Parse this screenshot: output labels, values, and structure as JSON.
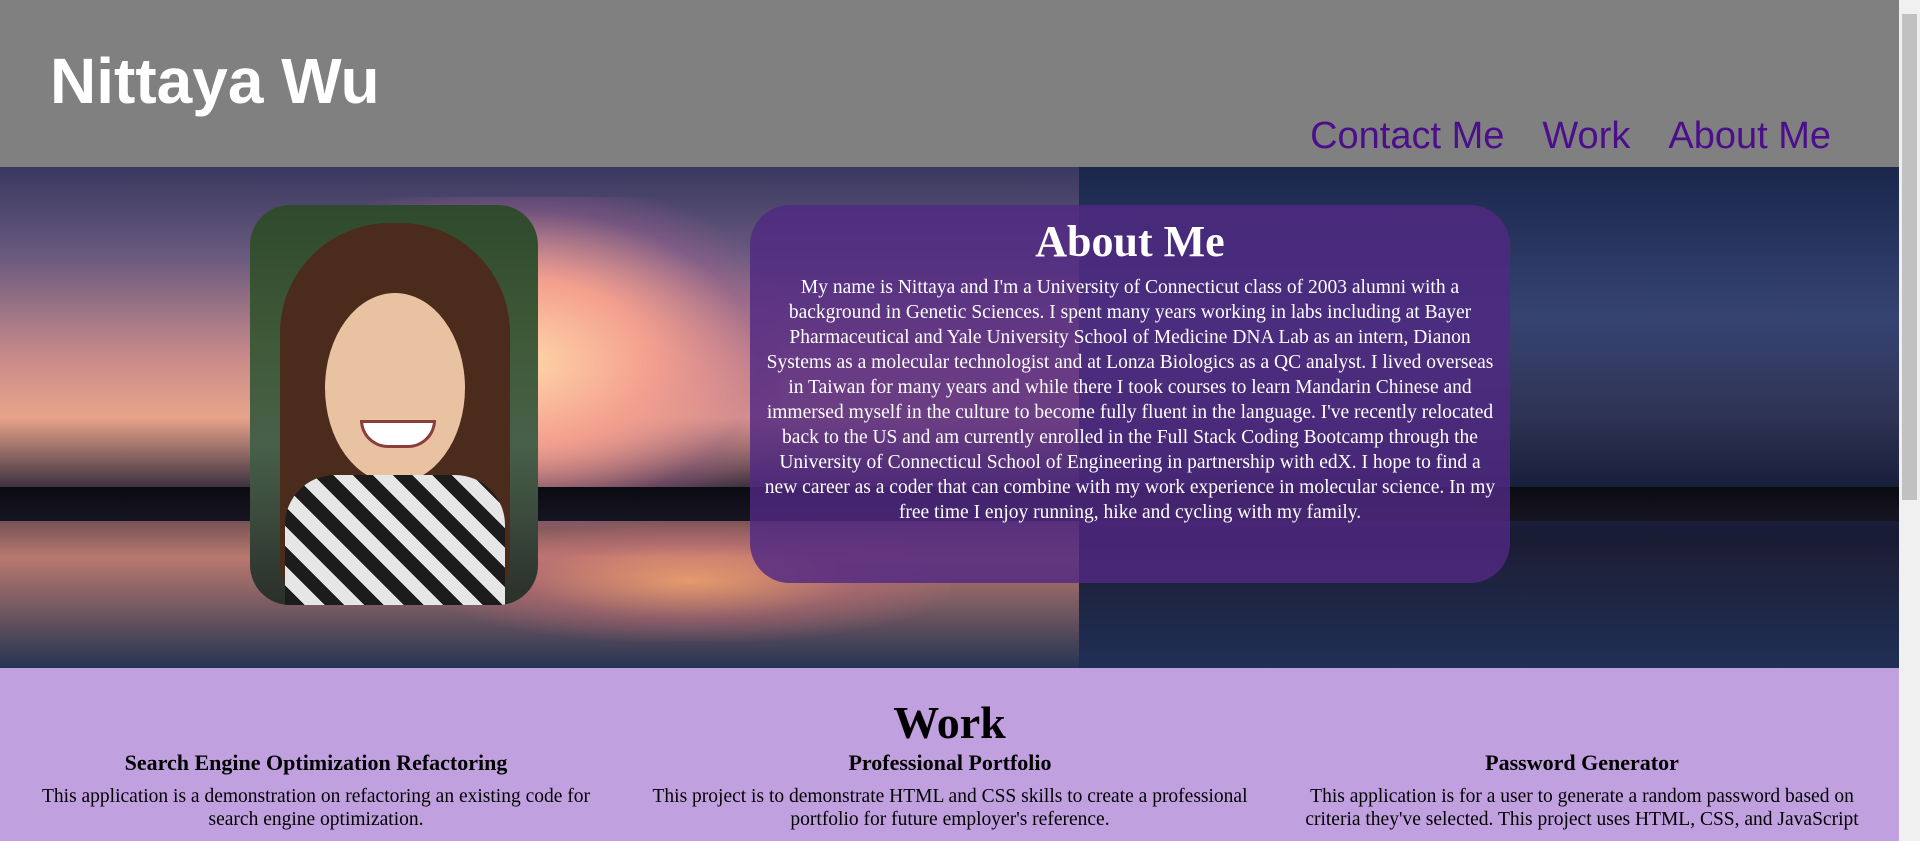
{
  "header": {
    "site_title": "Nittaya Wu",
    "nav": [
      "Contact Me",
      "Work",
      "About Me"
    ]
  },
  "about": {
    "heading": "About Me",
    "photo_description": "profile-photo",
    "body": "My name is Nittaya and I'm a University of Connecticut class of 2003 alumni with a background in Genetic Sciences. I spent many years working in labs including at Bayer Pharmaceutical and Yale University School of Medicine DNA Lab as an intern, Dianon Systems as a molecular technologist and at Lonza Biologics as a QC analyst. I lived overseas in Taiwan for many years and while there I took courses to learn Mandarin Chinese and immersed myself in the culture to become fully fluent in the language. I've recently relocated back to the US and am currently enrolled in the Full Stack Coding Bootcamp through the University of Connecticul School of Engineering in partnership with edX. I hope to find a new career as a coder that can combine with my work experience in molecular science. In my free time I enjoy running, hike and cycling with my family."
  },
  "work": {
    "heading": "Work",
    "projects": [
      {
        "title": "Search Engine Optimization Refactoring",
        "description": "This application is a demonstration on refactoring an existing code for search engine optimization."
      },
      {
        "title": "Professional Portfolio",
        "description": "This project is to demonstrate HTML and CSS skills to create a professional portfolio for future employer's reference."
      },
      {
        "title": "Password Generator",
        "description": "This application is for a user to generate a random password based on criteria they've selected. This project uses HTML, CSS, and JavaScript"
      }
    ]
  },
  "colors": {
    "header_bg": "#808080",
    "nav_link": "#4b0f8c",
    "card_bg": "#50288c",
    "work_bg": "#c1a0e0"
  }
}
